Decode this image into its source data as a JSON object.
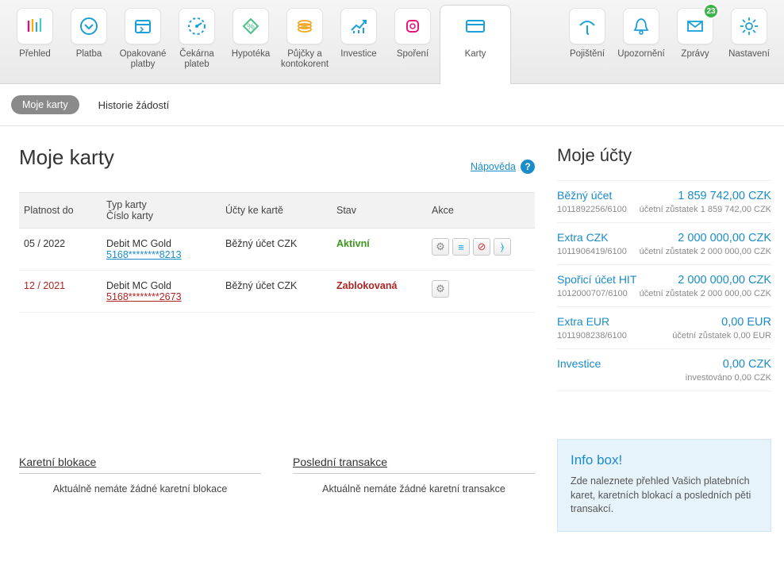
{
  "nav": {
    "items": [
      {
        "label": "Přehled"
      },
      {
        "label": "Platba"
      },
      {
        "label": "Opakované platby"
      },
      {
        "label": "Čekárna plateb"
      },
      {
        "label": "Hypotéka"
      },
      {
        "label": "Půjčky a kontokorent"
      },
      {
        "label": "Investice"
      },
      {
        "label": "Spoření"
      },
      {
        "label": "Karty"
      },
      {
        "label": "Pojištění"
      },
      {
        "label": "Upozornění"
      },
      {
        "label": "Zprávy",
        "badge": "23"
      },
      {
        "label": "Nastavení"
      }
    ]
  },
  "subtabs": {
    "active": "Moje karty",
    "other": "Historie žádostí"
  },
  "page": {
    "title": "Moje karty",
    "help": "Nápověda"
  },
  "table": {
    "headers": {
      "validity": "Platnost do",
      "cardtype": "Typ karty",
      "cardnum_label": "Číslo karty",
      "accounts": "Účty ke kartě",
      "status": "Stav",
      "actions": "Akce"
    },
    "rows": [
      {
        "validity": "05 / 2022",
        "cardtype": "Debit MC Gold",
        "cardnum": "5168********8213",
        "account": "Běžný účet CZK",
        "status": "Aktivní",
        "status_kind": "active"
      },
      {
        "validity": "12 / 2021",
        "cardtype": "Debit MC Gold",
        "cardnum": "5168********2673",
        "account": "Běžný účet CZK",
        "status": "Zablokovaná",
        "status_kind": "blocked"
      }
    ]
  },
  "accounts": {
    "title": "Moje účty",
    "items": [
      {
        "name": "Běžný účet",
        "balance": "1 859 742,00 CZK",
        "num": "1011892256/6100",
        "sub": "účetní zůstatek 1 859 742,00 CZK"
      },
      {
        "name": "Extra CZK",
        "balance": "2 000 000,00 CZK",
        "num": "1011906419/6100",
        "sub": "účetní zůstatek 2 000 000,00 CZK"
      },
      {
        "name": "Spořicí účet HIT",
        "balance": "2 000 000,00 CZK",
        "num": "1012000707/6100",
        "sub": "účetní zůstatek 2 000 000,00 CZK"
      },
      {
        "name": "Extra EUR",
        "balance": "0,00 EUR",
        "num": "1011908238/6100",
        "sub": "účetní zůstatek 0,00 EUR"
      },
      {
        "name": "Investice",
        "balance": "0,00 CZK",
        "num": "",
        "sub": "investováno 0,00 CZK"
      }
    ]
  },
  "infobox": {
    "title": "Info box!",
    "text": "Zde naleznete přehled Vašich platebních karet, karetních blokací a posledních pěti transakcí."
  },
  "panels": {
    "blocks_title": "Karetní blokace",
    "blocks_empty": "Aktuálně nemáte žádné karetní blokace",
    "tx_title": "Poslední transakce",
    "tx_empty": "Aktuálně nemáte žádné karetní transakce"
  }
}
